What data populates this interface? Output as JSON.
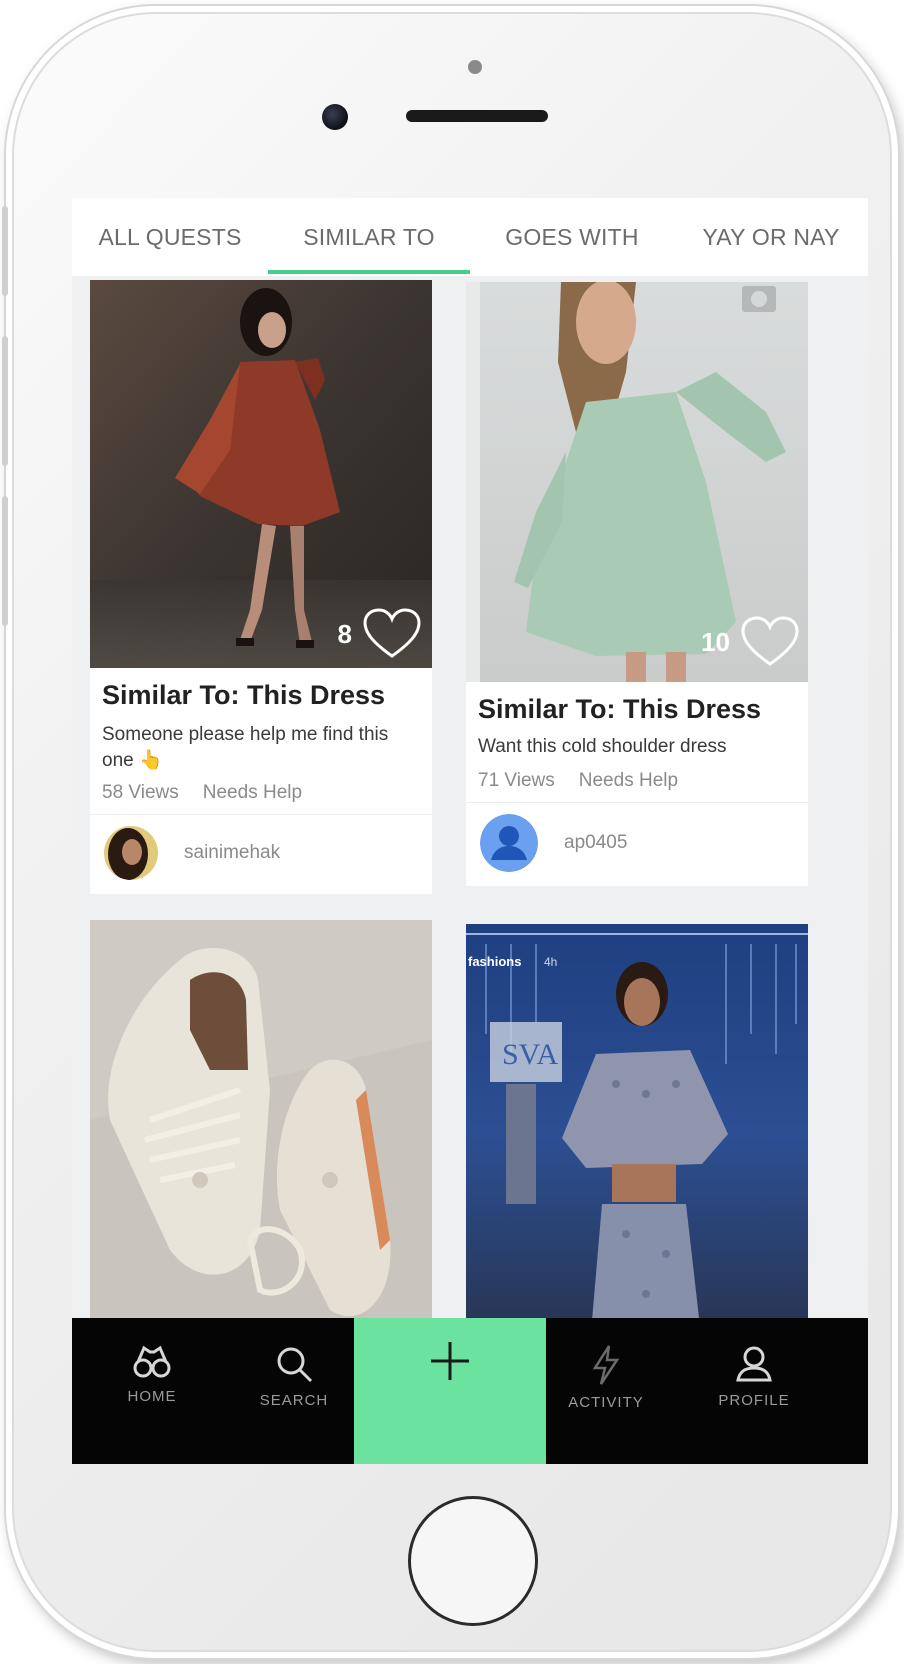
{
  "tabs": [
    {
      "label": "ALL QUESTS",
      "active": false
    },
    {
      "label": "SIMILAR TO",
      "active": true
    },
    {
      "label": "GOES WITH",
      "active": false
    },
    {
      "label": "YAY OR NAY",
      "active": false
    }
  ],
  "cards": [
    {
      "likes": "8",
      "title": "Similar To: This Dress",
      "description": "Someone please help me find this one 👆",
      "views": "58 Views",
      "status": "Needs Help",
      "username": "sainimehak"
    },
    {
      "likes": "10",
      "title": "Similar To: This Dress",
      "description": "Want this cold shoulder dress",
      "views": "71 Views",
      "status": "Needs Help",
      "username": "ap0405"
    },
    {
      "image_text_1": "fashions",
      "image_text_2": "4h",
      "image_text_3": "SVA"
    }
  ],
  "bottom_nav": {
    "items": [
      {
        "icon": "binoculars-icon",
        "label": "HOME"
      },
      {
        "icon": "search-icon",
        "label": "SEARCH"
      },
      {
        "icon": "plus-icon",
        "label": ""
      },
      {
        "icon": "lightning-icon",
        "label": "ACTIVITY"
      },
      {
        "icon": "profile-icon",
        "label": "PROFILE"
      }
    ],
    "add_color": "#6be39e"
  },
  "colors": {
    "accent": "#3fd08a",
    "screen_bg": "#eef0f1"
  }
}
